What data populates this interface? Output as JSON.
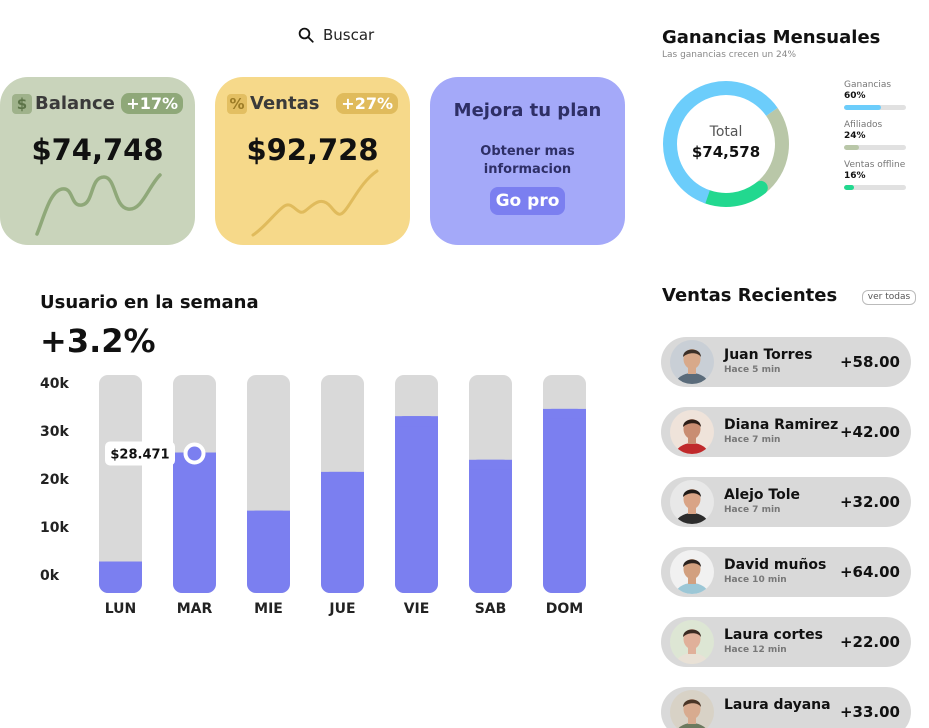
{
  "search": {
    "placeholder": "Buscar"
  },
  "cards": {
    "balance": {
      "label": "Balance",
      "icon_glyph": "$",
      "icon": "dollar-icon",
      "badge": "+17%",
      "value": "$74,748"
    },
    "ventas": {
      "label": "Ventas",
      "icon_glyph": "%",
      "icon": "percent-icon",
      "badge": "+27%",
      "value": "$92,728"
    },
    "plan": {
      "title": "Mejora tu plan",
      "subtitle": "Obtener mas informacion",
      "button": "Go pro"
    }
  },
  "ganancias": {
    "title": "Ganancias Mensuales",
    "subtitle": "Las ganancias crecen un 24%",
    "total_label": "Total",
    "total_value": "$74,578",
    "legend": [
      {
        "name": "Ganancias",
        "pct": "60%",
        "value": 0.6,
        "color": "#6ccdfb"
      },
      {
        "name": "Afiliados",
        "pct": "24%",
        "value": 0.24,
        "color": "#b9c7a8"
      },
      {
        "name": "Ventas offline",
        "pct": "16%",
        "value": 0.16,
        "color": "#22d88f"
      }
    ]
  },
  "usuario": {
    "title": "Usuario en la semana",
    "change": "+3.2%"
  },
  "chart_data": {
    "type": "bar",
    "categories": [
      "LUN",
      "MAR",
      "MIE",
      "JUE",
      "VIE",
      "SAB",
      "DOM"
    ],
    "values": [
      6500,
      29000,
      17000,
      25000,
      36500,
      27500,
      38000
    ],
    "ylim": [
      0,
      45000
    ],
    "y_ticks": [
      "0k",
      "10k",
      "20k",
      "30k",
      "40k"
    ],
    "tooltip": {
      "category": "MAR",
      "label": "$28.471"
    },
    "colors": {
      "bar": "#7b7ff0",
      "track": "#d9d9d9"
    }
  },
  "recientes": {
    "title": "Ventas Recientes",
    "ver_todas": "ver todas",
    "items": [
      {
        "name": "Juan Torres",
        "time": "Hace 5 min",
        "amount": "+58.00"
      },
      {
        "name": "Diana Ramirez",
        "time": "Hace 7 min",
        "amount": "+42.00"
      },
      {
        "name": "Alejo Tole",
        "time": "Hace 7 min",
        "amount": "+32.00"
      },
      {
        "name": "David muños",
        "time": "Hace 10 min",
        "amount": "+64.00"
      },
      {
        "name": "Laura cortes",
        "time": "Hace 12 min",
        "amount": "+22.00"
      },
      {
        "name": "Laura dayana",
        "time": "",
        "amount": "+33.00"
      }
    ]
  }
}
